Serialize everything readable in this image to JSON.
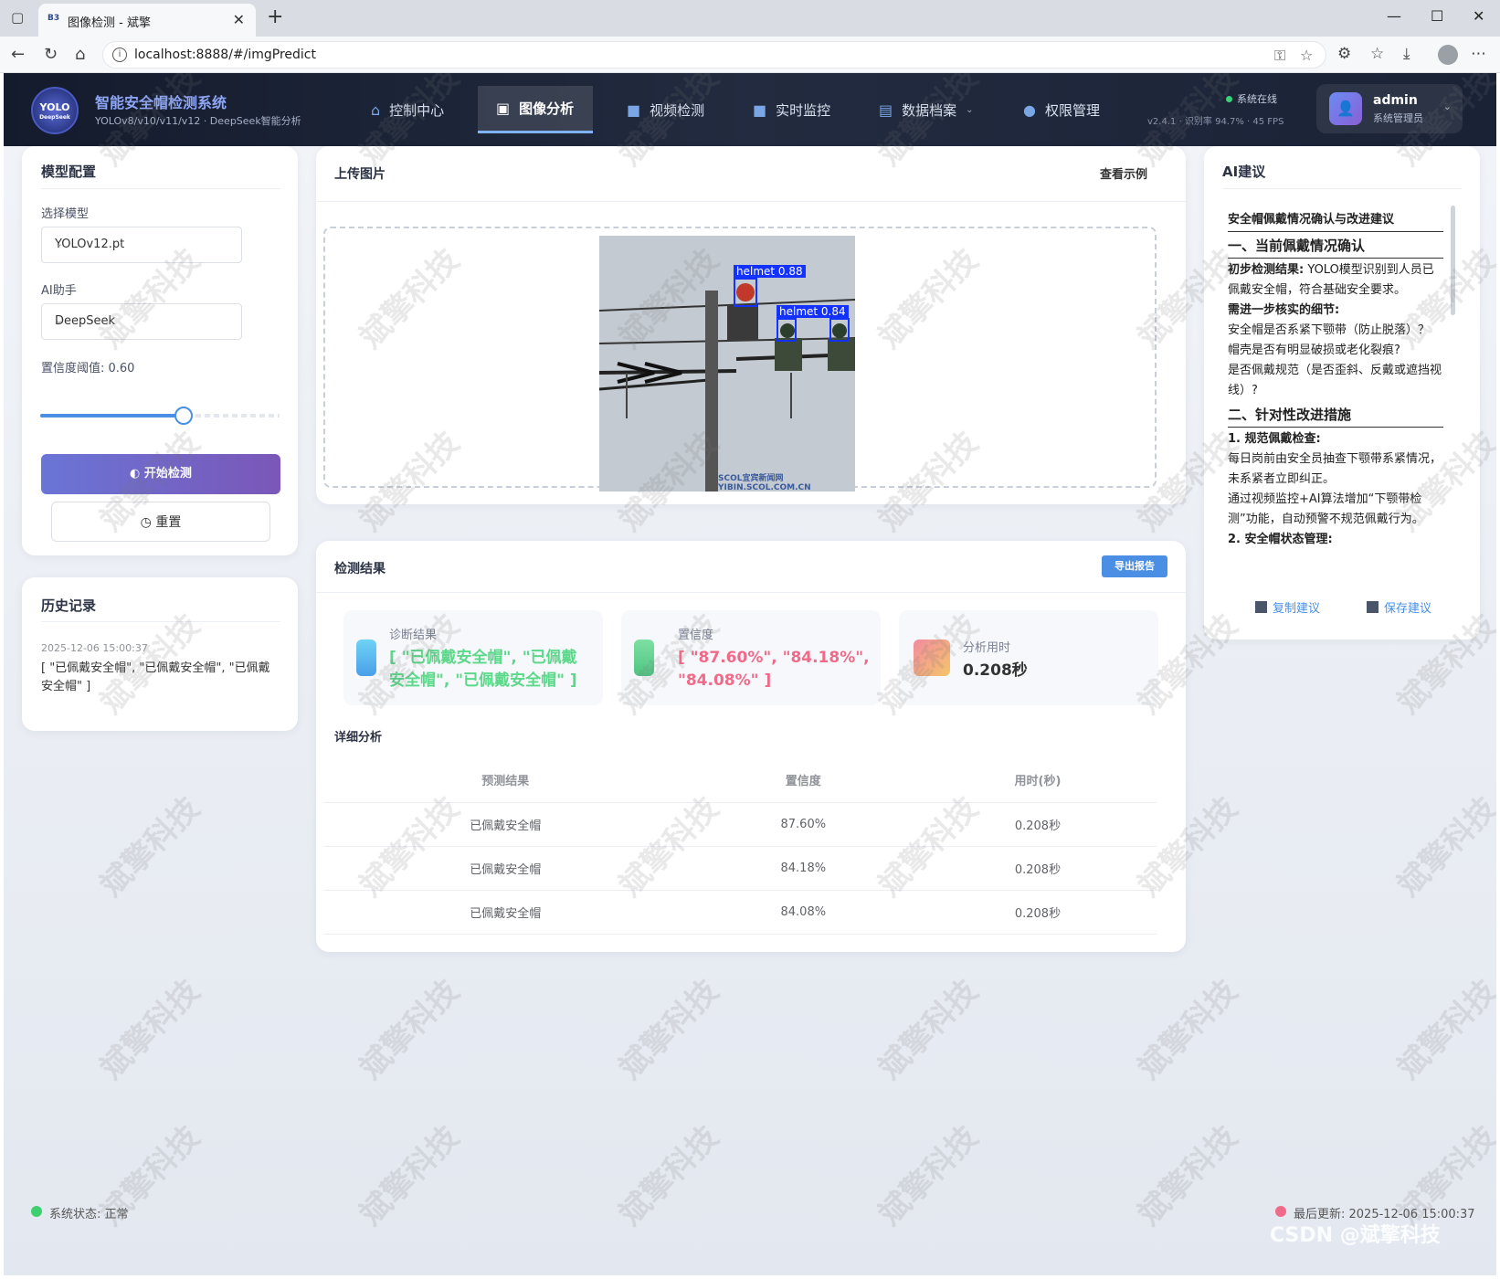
{
  "browser": {
    "tab_title": "图像检测 - 斌擎",
    "url": "localhost:8888/#/imgPredict"
  },
  "header": {
    "logo_text": "YOLO",
    "logo_sub": "DeepSeek",
    "title": "智能安全帽检测系统",
    "subtitle": "YOLOv8/v10/v11/v12 · DeepSeek智能分析",
    "nav": [
      {
        "label": "控制中心",
        "icon": "home-icon"
      },
      {
        "label": "图像分析",
        "icon": "image-icon"
      },
      {
        "label": "视频检测",
        "icon": "video-icon"
      },
      {
        "label": "实时监控",
        "icon": "camera-icon"
      },
      {
        "label": "数据档案",
        "icon": "document-icon"
      },
      {
        "label": "权限管理",
        "icon": "user-icon"
      }
    ],
    "status": "系统在线",
    "version": "v2.4.1 · 识别率 94.7% · 45 FPS",
    "user_name": "admin",
    "user_role": "系统管理员"
  },
  "model_config": {
    "title": "模型配置",
    "model_label": "选择模型",
    "model_value": "YOLOv12.pt",
    "ai_label": "AI助手",
    "ai_value": "DeepSeek",
    "threshold_label": "置信度阈值: 0.60",
    "threshold": 0.6,
    "start_button": "开始检测",
    "reset_button": "重置"
  },
  "history": {
    "title": "历史记录",
    "items": [
      {
        "time": "2025-12-06 15:00:37",
        "result": "[ \"已佩戴安全帽\", \"已佩戴安全帽\", \"已佩戴安全帽\" ]"
      }
    ]
  },
  "upload": {
    "title": "上传图片",
    "example_link": "查看示例",
    "detections": [
      {
        "label": "helmet  0.88"
      },
      {
        "label": "helmet  0.84"
      }
    ],
    "image_watermark": "SCOL宜宾新闻网 YIBIN.SCOL.COM.CN"
  },
  "results": {
    "title": "检测结果",
    "export_button": "导出报告",
    "diagnosis_label": "诊断结果",
    "diagnosis_value": "[ \"已佩戴安全帽\", \"已佩戴安全帽\", \"已佩戴安全帽\" ]",
    "confidence_label": "置信度",
    "confidence_value": "[ \"87.60%\", \"84.18%\", \"84.08%\" ]",
    "time_label": "分析用时",
    "time_value": "0.208秒",
    "detail_title": "详细分析",
    "columns": [
      "预测结果",
      "置信度",
      "用时(秒)"
    ],
    "rows": [
      [
        "已佩戴安全帽",
        "87.60%",
        "0.208秒"
      ],
      [
        "已佩戴安全帽",
        "84.18%",
        "0.208秒"
      ],
      [
        "已佩戴安全帽",
        "84.08%",
        "0.208秒"
      ]
    ]
  },
  "ai": {
    "title": "AI建议",
    "heading": "安全帽佩戴情况确认与改进建议",
    "section1": "一、当前佩戴情况确认",
    "p1_bold": "初步检测结果:",
    "p1_text": " YOLO模型识别到人员已佩戴安全帽，符合基础安全要求。",
    "p2_bold": "需进一步核实的细节:",
    "q1": "安全帽是否系紧下颚带（防止脱落）？",
    "q2": "帽壳是否有明显破损或老化裂痕?",
    "q3": "是否佩戴规范（是否歪斜、反戴或遮挡视线）?",
    "section2": "二、针对性改进措施",
    "m1_bold": "1. 规范佩戴检查:",
    "m1_a": "每日岗前由安全员抽查下颚带系紧情况，未系紧者立即纠正。",
    "m1_b": "通过视频监控+AI算法增加“下颚带检测”功能，自动预警不规范佩戴行为。",
    "m2_bold": "2. 安全帽状态管理:",
    "copy_button": "复制建议",
    "save_button": "保存建议"
  },
  "footer": {
    "status": "系统状态: 正常",
    "updated": "最后更新: 2025-12-06 15:00:37",
    "csdn": "CSDN @斌擎科技"
  },
  "watermark_text": "斌擎科技",
  "colors": {
    "accent": "#4a8fe4",
    "success": "#5bd88a",
    "danger": "#f06b8a",
    "primary_gradient_start": "#6a75d6",
    "primary_gradient_end": "#7a57b8"
  }
}
